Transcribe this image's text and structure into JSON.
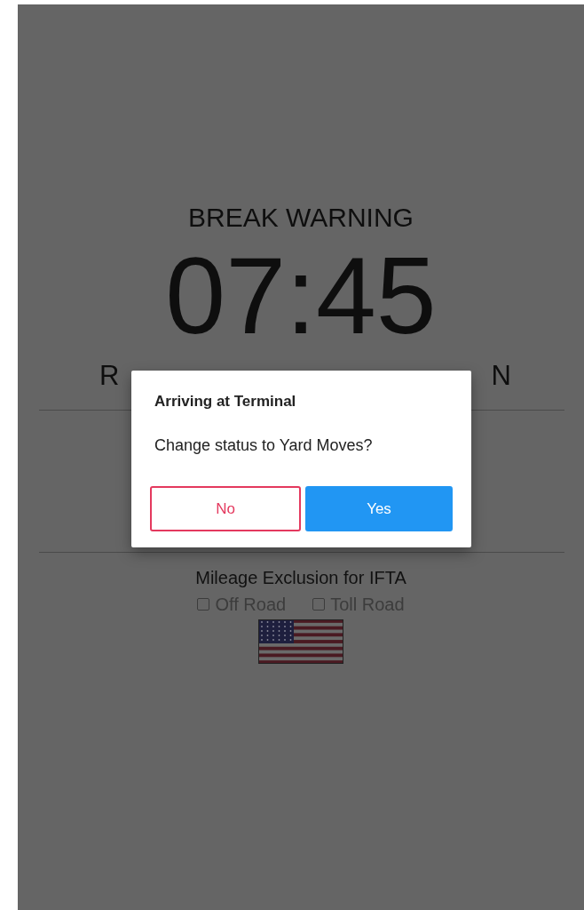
{
  "screen": {
    "title": "BREAK WARNING",
    "timer": "07:45",
    "status_left": "R",
    "status_right": "N"
  },
  "mileage": {
    "heading": "Mileage Exclusion for IFTA",
    "options": [
      {
        "label": "Off Road",
        "checked": false
      },
      {
        "label": "Toll Road",
        "checked": false
      }
    ]
  },
  "dialog": {
    "title": "Arriving at Terminal",
    "message": "Change status to Yard Moves?",
    "buttons": [
      {
        "label": "No",
        "kind": "outline"
      },
      {
        "label": "Yes",
        "kind": "primary"
      }
    ]
  }
}
